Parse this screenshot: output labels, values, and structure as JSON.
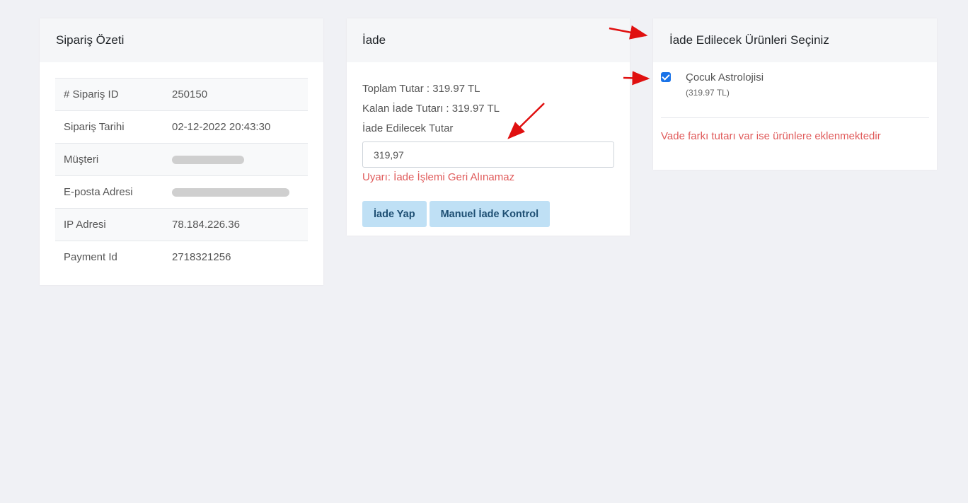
{
  "summary": {
    "title": "Sipariş Özeti",
    "rows": [
      {
        "label": "# Sipariş ID",
        "value": "250150"
      },
      {
        "label": "Sipariş Tarihi",
        "value": "02-12-2022 20:43:30"
      },
      {
        "label": "Müşteri",
        "value": ""
      },
      {
        "label": "E-posta Adresi",
        "value": ""
      },
      {
        "label": "IP Adresi",
        "value": "78.184.226.36"
      },
      {
        "label": "Payment Id",
        "value": "2718321256"
      }
    ]
  },
  "refund": {
    "title": "İade",
    "total_line": "Toplam Tutar : 319.97 TL",
    "remaining_line": "Kalan İade Tutarı : 319.97 TL",
    "amount_label": "İade Edilecek Tutar",
    "amount_value": "319,97",
    "warning": "Uyarı: İade İşlemi Geri Alınamaz",
    "refund_button": "İade Yap",
    "manual_button": "Manuel İade Kontrol"
  },
  "products": {
    "title": "İade Edilecek Ürünleri Seçiniz",
    "items": [
      {
        "name": "Çocuk Astrolojisi",
        "price": "(319.97 TL)",
        "checked": true
      }
    ],
    "note": "Vade farkı tutarı var ise ürünlere eklenmektedir"
  },
  "colors": {
    "background": "#f0f1f5",
    "warning": "#e05b5b",
    "button_bg": "#bfe0f5",
    "button_text": "#1e4f73",
    "checkbox": "#1a73e8",
    "annotation_arrow": "#e01010"
  }
}
